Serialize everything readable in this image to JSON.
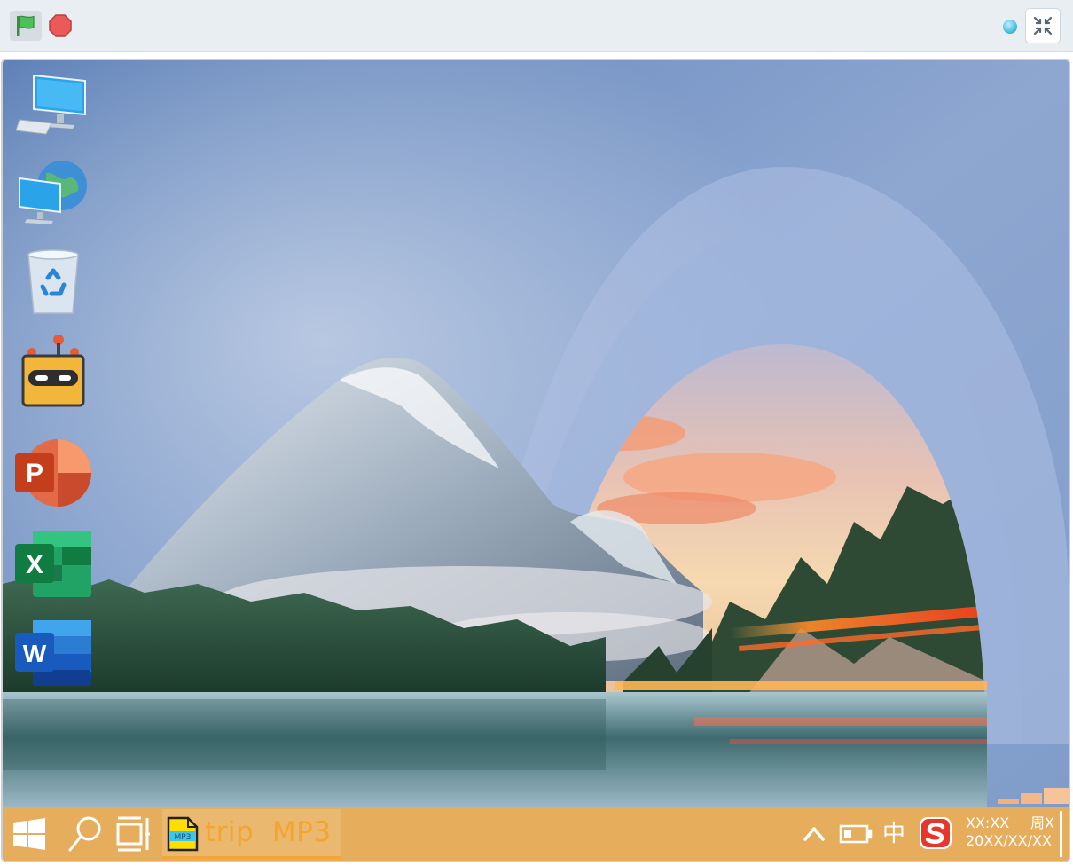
{
  "toolbar": {
    "green_flag_icon": "green-flag-icon",
    "stop_icon": "stop-icon",
    "exit_fullscreen_icon": "exit-fullscreen-icon"
  },
  "desktop": {
    "icons": [
      {
        "name": "computer-icon"
      },
      {
        "name": "network-icon"
      },
      {
        "name": "recycle-bin-icon"
      },
      {
        "name": "robot-app-icon"
      },
      {
        "name": "powerpoint-icon",
        "letter": "P"
      },
      {
        "name": "excel-icon",
        "letter": "X"
      },
      {
        "name": "word-icon",
        "letter": "W"
      }
    ]
  },
  "taskbar": {
    "open_app": {
      "icon_text": "MP3",
      "label": "trip  MP3"
    },
    "tray": {
      "ime": "中",
      "time": "XX:XX",
      "day": "周X",
      "date": "20XX/XX/XX"
    }
  },
  "colors": {
    "taskbar": "#e6ad5c",
    "app_label": "#f4a52d",
    "topbar": "#e9eef2"
  }
}
